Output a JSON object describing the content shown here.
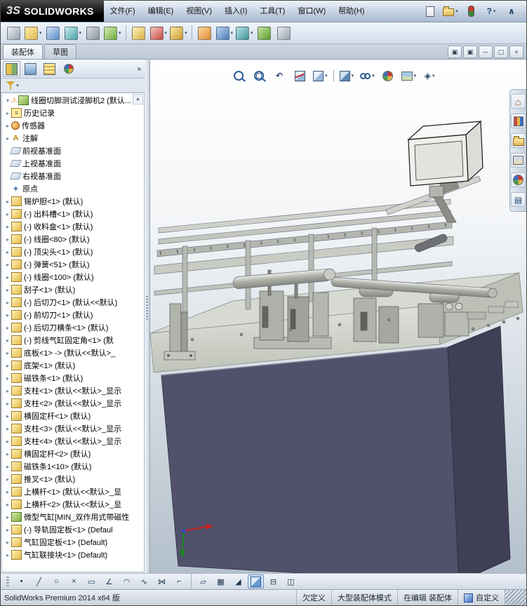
{
  "titlebar": {
    "logo_mark": "3S",
    "logo_text": "SOLIDWORKS",
    "menus": [
      "文件(F)",
      "编辑(E)",
      "视图(V)",
      "插入(I)",
      "工具(T)",
      "窗口(W)",
      "帮助(H)"
    ],
    "quick_actions": [
      {
        "name": "new-document"
      },
      {
        "name": "open",
        "dropdown": true
      },
      {
        "name": "solidworks-resources"
      },
      {
        "name": "help",
        "dropdown": true
      },
      {
        "name": "collapse-menubar"
      }
    ]
  },
  "toolbar": {
    "items": [
      {
        "name": "edit-component"
      },
      {
        "name": "insert-components",
        "dropdown": true
      },
      {
        "name": "mate"
      },
      {
        "name": "linear-component-pattern",
        "dropdown": true
      },
      {
        "name": "smart-fasteners"
      },
      {
        "name": "move-component",
        "dropdown": true
      },
      {
        "sep": true
      },
      {
        "name": "show-hidden-components"
      },
      {
        "name": "assembly-features",
        "dropdown": true
      },
      {
        "name": "reference-geometry",
        "dropdown": true
      },
      {
        "sep": true
      },
      {
        "name": "new-motion-study"
      },
      {
        "name": "bill-of-materials",
        "dropdown": true
      },
      {
        "name": "exploded-view",
        "dropdown": true
      },
      {
        "name": "instant3d"
      },
      {
        "name": "external-references"
      }
    ]
  },
  "command_tabs": [
    {
      "label": "装配体",
      "active": true
    },
    {
      "label": "草图",
      "active": false
    }
  ],
  "window_controls": [
    {
      "name": "window-list"
    },
    {
      "name": "window-tile"
    },
    {
      "name": "minimize"
    },
    {
      "name": "restore"
    },
    {
      "name": "close"
    }
  ],
  "panel": {
    "tabs": [
      {
        "name": "featuremanager",
        "active": true
      },
      {
        "name": "propertymanager"
      },
      {
        "name": "configurationmanager"
      },
      {
        "name": "displaymanager"
      }
    ],
    "overflow": "»",
    "filter_icon": "filter",
    "tree_rows": [
      {
        "text": "线圈切脚测试浸脚机2 (默认...",
        "icon": "assembly",
        "arrow": "down",
        "warn": true
      },
      {
        "text": "历史记录",
        "icon": "history",
        "arrow": "right"
      },
      {
        "text": "传感器",
        "icon": "sensor",
        "arrow": "right"
      },
      {
        "text": "注解",
        "icon": "annotation",
        "arrow": "right"
      },
      {
        "text": "前视基准面",
        "icon": "plane"
      },
      {
        "text": "上视基准面",
        "icon": "plane"
      },
      {
        "text": "右视基准面",
        "icon": "plane"
      },
      {
        "text": "原点",
        "icon": "origin"
      },
      {
        "text": "锡炉胆<1> (默认)",
        "icon": "part",
        "arrow": "right"
      },
      {
        "text": "(-) 出料槽<1> (默认)",
        "icon": "part",
        "arrow": "right"
      },
      {
        "text": "(-) 收料盒<1> (默认)",
        "icon": "part",
        "arrow": "right"
      },
      {
        "text": "(-) 线圈<80> (默认)",
        "icon": "part",
        "arrow": "right"
      },
      {
        "text": "(-) 顶尖头<1> (默认)",
        "icon": "part",
        "arrow": "right"
      },
      {
        "text": "(-) 弹簧<51> (默认)",
        "icon": "part",
        "arrow": "right"
      },
      {
        "text": "(-) 线圈<100> (默认)",
        "icon": "part",
        "arrow": "right"
      },
      {
        "text": "刮子<1> (默认)",
        "icon": "part",
        "arrow": "right"
      },
      {
        "text": "(-) 后切刀<1> (默认<<默认)",
        "icon": "part",
        "arrow": "right"
      },
      {
        "text": "(-) 前切刀<1> (默认)",
        "icon": "part",
        "arrow": "right"
      },
      {
        "text": "(-) 后切刀横条<1> (默认)",
        "icon": "part",
        "arrow": "right"
      },
      {
        "text": "(-) 剪线气缸固定角<1> (默",
        "icon": "part",
        "arrow": "right"
      },
      {
        "text": "底板<1> -> (默认<<默认>_",
        "icon": "part",
        "arrow": "right"
      },
      {
        "text": "底架<1> (默认)",
        "icon": "part",
        "arrow": "right"
      },
      {
        "text": "磁铁条<1> (默认)",
        "icon": "part",
        "arrow": "right"
      },
      {
        "text": "支柱<1> (默认<<默认>_显示",
        "icon": "part",
        "arrow": "right"
      },
      {
        "text": "支柱<2> (默认<<默认>_显示",
        "icon": "part",
        "arrow": "right"
      },
      {
        "text": "横固定杆<1> (默认)",
        "icon": "part",
        "arrow": "right"
      },
      {
        "text": "支柱<3> (默认<<默认>_显示",
        "icon": "part",
        "arrow": "right"
      },
      {
        "text": "支柱<4> (默认<<默认>_显示",
        "icon": "part",
        "arrow": "right"
      },
      {
        "text": "横固定杆<2> (默认)",
        "icon": "part",
        "arrow": "right"
      },
      {
        "text": "磁铁条1<10> (默认)",
        "icon": "part",
        "arrow": "right"
      },
      {
        "text": "推叉<1> (默认)",
        "icon": "part",
        "arrow": "right"
      },
      {
        "text": "上横杆<1> (默认<<默认>_显",
        "icon": "part",
        "arrow": "right"
      },
      {
        "text": "上横杆<2> (默认<<默认>_显",
        "icon": "part",
        "arrow": "right"
      },
      {
        "text": "微型气缸[MIN_双作用式带磁性",
        "icon": "assembly",
        "arrow": "right"
      },
      {
        "text": "(-) 导轨固定板<1> (Defaul",
        "icon": "part",
        "arrow": "right"
      },
      {
        "text": "气缸固定板<1> (Default)",
        "icon": "part",
        "arrow": "right"
      },
      {
        "text": "气缸联接块<1> (Default)",
        "icon": "part",
        "arrow": "right"
      }
    ]
  },
  "viewport": {
    "hud": [
      {
        "name": "zoom-to-fit"
      },
      {
        "name": "zoom-to-area"
      },
      {
        "name": "previous-view"
      },
      {
        "name": "section-view"
      },
      {
        "name": "view-orientation",
        "dropdown": true
      },
      {
        "sep": true
      },
      {
        "name": "display-style",
        "dropdown": true
      },
      {
        "name": "hide-show-items",
        "dropdown": true
      },
      {
        "name": "edit-appearance"
      },
      {
        "name": "apply-scene",
        "dropdown": true
      },
      {
        "name": "view-settings",
        "dropdown": true
      }
    ],
    "taskpane": [
      {
        "name": "resources-home"
      },
      {
        "name": "design-library"
      },
      {
        "name": "file-explorer"
      },
      {
        "name": "view-palette"
      },
      {
        "name": "appearances-scenes"
      },
      {
        "name": "custom-properties"
      }
    ]
  },
  "sketchbar": [
    {
      "name": "sketch-point"
    },
    {
      "name": "sketch-line"
    },
    {
      "name": "sketch-circle"
    },
    {
      "name": "trim-entities"
    },
    {
      "name": "sketch-rectangle"
    },
    {
      "name": "sketch-angle"
    },
    {
      "name": "sketch-arc"
    },
    {
      "name": "sketch-spline"
    },
    {
      "name": "mirror-entities"
    },
    {
      "name": "offset-entities"
    },
    {
      "sep": true
    },
    {
      "name": "reference-plane"
    },
    {
      "name": "grid-system"
    },
    {
      "name": "section-line"
    },
    {
      "name": "shaded-with-edges",
      "active": true
    },
    {
      "name": "split-horizontal"
    },
    {
      "name": "split-vertical"
    }
  ],
  "statusbar": {
    "left": "SolidWorks Premium 2014 x64 版",
    "cells": [
      "欠定义",
      "大型装配体模式",
      "在编辑 装配体"
    ],
    "custom_label": "自定义"
  }
}
